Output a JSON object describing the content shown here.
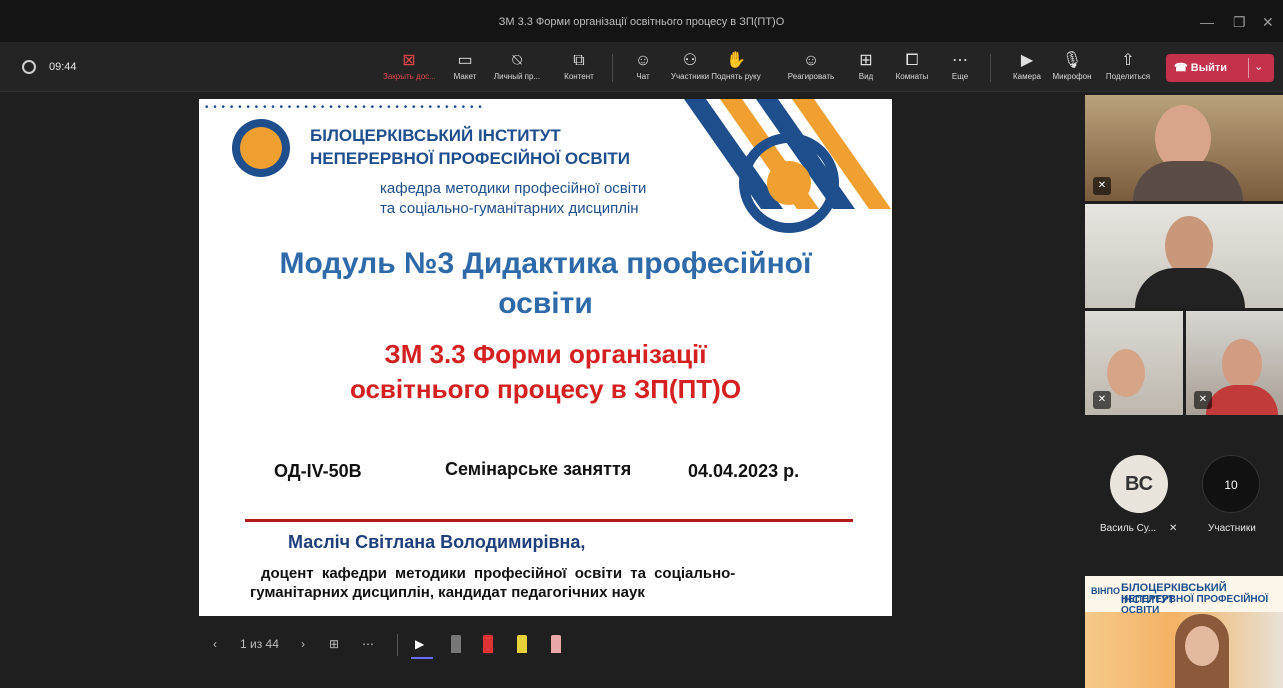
{
  "window": {
    "title": "ЗМ 3.3 Форми організації освітнього процесу в ЗП(ПТ)О",
    "minimize": "—",
    "restore": "❐",
    "close": "✕"
  },
  "meeting": {
    "time": "09:44"
  },
  "toolbar": {
    "items": [
      {
        "label": "Закрыть дос...",
        "icon": "close-share-icon",
        "glyph": "⊠"
      },
      {
        "label": "Макет",
        "icon": "layout-icon",
        "glyph": "▭"
      },
      {
        "label": "Личный пр...",
        "icon": "incognito-icon",
        "glyph": "⍉"
      },
      {
        "label": "Контент",
        "icon": "content-icon",
        "glyph": "⧉"
      },
      {
        "label": "Чат",
        "icon": "chat-icon",
        "glyph": "☺"
      },
      {
        "label": "Участники",
        "icon": "people-icon",
        "glyph": "⚇"
      },
      {
        "label": "Поднять руку",
        "icon": "raise-hand-icon",
        "glyph": "✋"
      },
      {
        "label": "Реагировать",
        "icon": "react-icon",
        "glyph": "☺"
      },
      {
        "label": "Вид",
        "icon": "view-icon",
        "glyph": "⊞"
      },
      {
        "label": "Комнаты",
        "icon": "rooms-icon",
        "glyph": "⧠"
      },
      {
        "label": "Еще",
        "icon": "more-icon",
        "glyph": "⋯"
      },
      {
        "label": "Камера",
        "icon": "camera-icon",
        "glyph": "▶"
      },
      {
        "label": "Микрофон",
        "icon": "microphone-icon",
        "glyph": "🎙"
      },
      {
        "label": "Поделиться",
        "icon": "share-icon",
        "glyph": "⇧"
      }
    ],
    "leave_label": "Выйти",
    "leave_glyph": "☎",
    "leave_chevron": "⌄"
  },
  "slide": {
    "dots": "• • • • • • • • • • • • • • • • • • • • • • • • • • • • • • • • • •",
    "institute_line1": "БІЛОЦЕРКІВСЬКИЙ ІНСТИТУТ",
    "institute_line2": "НЕПЕРЕРВНОЇ ПРОФЕСІЙНОЇ ОСВІТИ",
    "department_line1": "кафедра методики професійної освіти",
    "department_line2": "та соціально-гуманітарних дисциплін",
    "module_line1": "Модуль №3 Дидактика професійної",
    "module_line2": "освіти",
    "topic_line1": "ЗМ 3.3 Форми організації",
    "topic_line2": "освітнього процесу в ЗП(ПТ)О",
    "group_code": "ОД-IV-50B",
    "lesson_type": "Семінарське заняття",
    "date": "04.04.2023 р.",
    "author": "Масліч Світлана Володимирівна,",
    "position_line1": "доцент кафедри методики професійної освіти та соціально-",
    "position_line2": "гуманітарних дисциплін, кандидат педагогічних наук"
  },
  "presenter_controls": {
    "prev": "‹",
    "page": "1 из 44",
    "next": "›",
    "grid": "⊞",
    "more": "⋯",
    "pointer": "▶"
  },
  "participants": {
    "initials": "ВС",
    "name": "Василь Су...",
    "count": "10",
    "count_label": "Участники"
  },
  "shared_screen": {
    "logo": "ВІНПО",
    "header1": "БІЛОЦЕРКІВСЬКИЙ ІНСТИТУТ",
    "header2": "НЕПЕРЕРВНОЇ ПРОФЕСІЙНОЇ ОСВІТИ"
  },
  "colors": {
    "leave": "#c4314b",
    "slide_blue": "#2e6aa8",
    "slide_red": "#d42020",
    "slide_orange": "#f0a030"
  }
}
